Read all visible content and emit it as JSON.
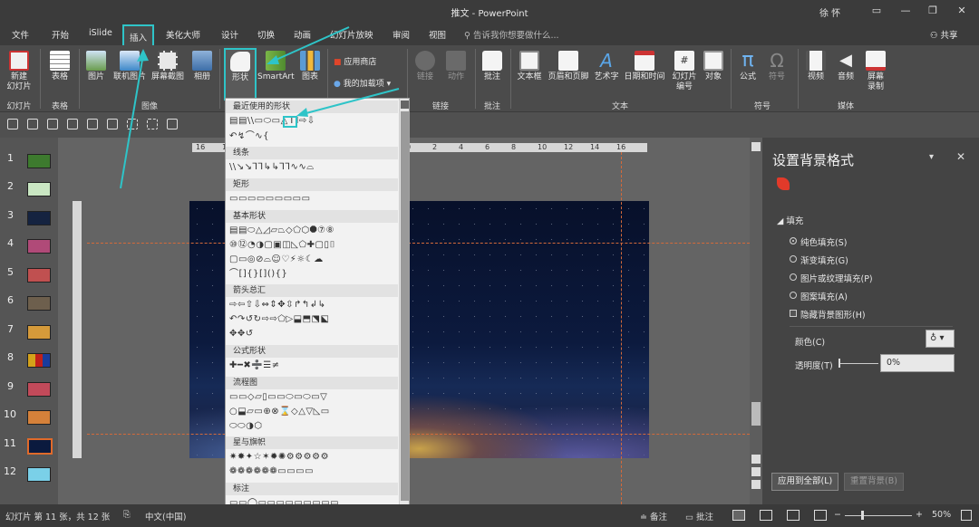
{
  "window": {
    "title": "推文  -  PowerPoint",
    "user": "徐 怀",
    "buttons": [
      "▭",
      "—",
      "❐",
      "✕"
    ]
  },
  "tabs": [
    "文件",
    "开始",
    "iSlide",
    "插入",
    "美化大师",
    "设计",
    "切换",
    "动画",
    "幻灯片放映",
    "审阅",
    "视图"
  ],
  "active_tab": "插入",
  "tell_me": "告诉我你想要做什么...",
  "share": "共享",
  "ribbon": {
    "new_slide": "新建\n幻灯片",
    "table": "表格",
    "picture": "图片",
    "online_picture": "联机图片",
    "screenshot": "屏幕截图",
    "album": "相册",
    "shapes": "形状",
    "smartart": "SmartArt",
    "chart": "图表",
    "store": "应用商店",
    "my_addins": "我的加载项",
    "link": "链接",
    "action": "动作",
    "comment": "批注",
    "textbox": "文本框",
    "header_footer": "页眉和页脚",
    "wordart": "艺术字",
    "date_time": "日期和时间",
    "slide_number": "幻灯片\n编号",
    "object": "对象",
    "equation": "公式",
    "symbol": "符号",
    "video": "视频",
    "audio": "音频",
    "screen_record": "屏幕\n录制",
    "groups": {
      "slides": "幻灯片",
      "tables": "表格",
      "images": "图像",
      "links": "链接",
      "comments": "批注",
      "text": "文本",
      "symbols": "符号",
      "media": "媒体"
    }
  },
  "ruler": {
    "h_labels": [
      "16",
      "14",
      "12",
      "10",
      "8",
      "6",
      "4",
      "2",
      "0",
      "2",
      "4",
      "6",
      "8",
      "10",
      "12",
      "14",
      "16"
    ]
  },
  "slides": [
    {
      "num": "1",
      "color": "#3d7a2e"
    },
    {
      "num": "2",
      "color": "#c9e6c2"
    },
    {
      "num": "3",
      "color": "#152340"
    },
    {
      "num": "4",
      "color": "#b04a78"
    },
    {
      "num": "5",
      "color": "#c05050"
    },
    {
      "num": "6",
      "color": "#6d5f4d"
    },
    {
      "num": "7",
      "color": "#d59a3a"
    },
    {
      "num": "8",
      "color": "#d4a21a"
    },
    {
      "num": "9",
      "color": "#c24a5a"
    },
    {
      "num": "10",
      "color": "#d5813a"
    },
    {
      "num": "11",
      "color": "#0b1a3e"
    },
    {
      "num": "12",
      "color": "#7ad0e8"
    }
  ],
  "current_slide": "11",
  "shapes_menu": {
    "sections": [
      {
        "title": "最近使用的形状",
        "rows": [
          "▤▤\\\\▭⬭▭△⅂⅂⇨⇩",
          "↶↯⌒∿{"
        ]
      },
      {
        "title": "线条",
        "rows": [
          "\\\\↘↘⅂⅂↳↳⅂⅂∿∿⌓"
        ]
      },
      {
        "title": "矩形",
        "rows": [
          "▭▭▭▭▭▭▭▭▭"
        ]
      },
      {
        "title": "基本形状",
        "rows": [
          "▤▤⬭△◿▱⏢◇⬠⬡⯃⑦⑧",
          "⑩⑫◔◑▢▣◫◺⬠✚▢▯⌷",
          "▢▭◎⊘⌓☺♡⚡☼☾☁",
          "⌒[]{}[](){}"
        ]
      },
      {
        "title": "箭头总汇",
        "rows": [
          "⇨⇦⇧⇩⇔⇕✥⇳↱↰↲↳",
          "↶↷↺↻⇨⇨⬠▷⬓⬒⬔⬕",
          "✥✥↺"
        ]
      },
      {
        "title": "公式形状",
        "rows": [
          "✚━✖➗☰≠"
        ]
      },
      {
        "title": "流程图",
        "rows": [
          "▭▭◇▱▯▭▭⬭▭⬭▭▽",
          "○⬓▱▭⊕⊗⌛◇△▽◺▭",
          "⬭⬭◑⬡"
        ]
      },
      {
        "title": "星与旗帜",
        "rows": [
          "✷✸✦☆✶✹✺⚙⚙⚙⚙⚙",
          "❁❁❁❁❁❁▭▭▭▭"
        ]
      },
      {
        "title": "标注",
        "rows": [
          "▭▭◯▭▭▭▭▭▭▭▭▭"
        ]
      }
    ]
  },
  "format_pane": {
    "title": "设置背景格式",
    "section": "填充",
    "options": [
      "纯色填充(S)",
      "渐变填充(G)",
      "图片或纹理填充(P)",
      "图案填充(A)"
    ],
    "hide_bg": "隐藏背景图形(H)",
    "color_label": "颜色(C)",
    "transparency_label": "透明度(T)",
    "transparency_value": "0%",
    "apply_all": "应用到全部(L)",
    "reset": "重置背景(B)"
  },
  "status": {
    "slide_info": "幻灯片 第 11 张，共 12 张",
    "language": "中文(中国)",
    "notes": "备注",
    "comments": "批注",
    "zoom": "50%"
  }
}
